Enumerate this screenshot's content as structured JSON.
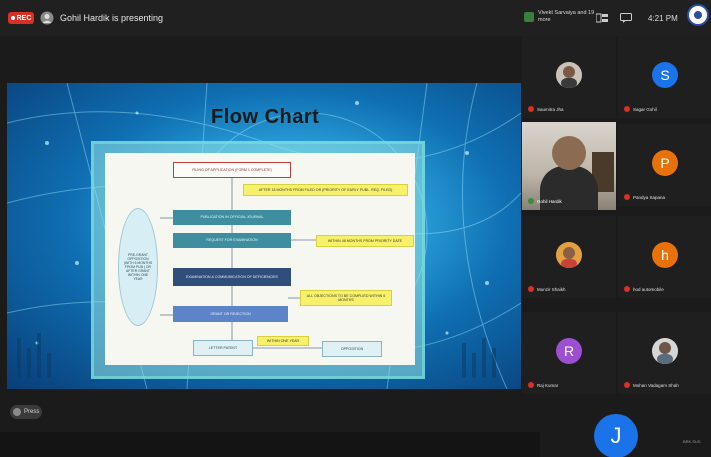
{
  "topbar": {
    "rec_label": "REC",
    "presenting_text": "Gohil Hardik is presenting",
    "viewers_text": "Vivekt Sarvaiya and 19 more",
    "time": "4:21 PM"
  },
  "slide": {
    "title": "Flow Chart",
    "boxes": [
      "FILING OF APPLICATION (FORM 1 COMPLETE)",
      "AFTER 18 MONTHS FROM FILED OR (PRIORITY OF EARLY PUBL. REQ. FILED)",
      "PUBLICATION IN OFFICIAL JOURNAL",
      "REQUEST FOR EXAMINATION",
      "WITHIN 48 MONTHS FROM PRIORITY DATE",
      "EXAMINATION & COMMUNICATION OF DEFICIENCIES",
      "ALL OBJECTIONS TO BE COMPLIED WITHIN 6 MONTHS",
      "GRANT OR REJECTION",
      "LETTER PATENT",
      "WITHIN ONE YEAR",
      "OPPOSITION"
    ],
    "ellipse_text": "PRE-GRANT OPPOSITION (WITH 6 MONTHS FROM PUB.) OR AFTER GRANT WITHIN ONE YEAR",
    "press_label": "Press"
  },
  "participants": [
    {
      "name": "Saumitra Jha",
      "type": "photo"
    },
    {
      "name": "Sagar Gohil",
      "type": "letter",
      "letter": "S",
      "color": "#1a73e8"
    },
    {
      "name": "Gohil Hardik",
      "type": "video"
    },
    {
      "name": "Pandya Sapana",
      "type": "letter",
      "letter": "P",
      "color": "#e8710a"
    },
    {
      "name": "Munzir Shaikh",
      "type": "photo"
    },
    {
      "name": "hod automobile",
      "type": "letter",
      "letter": "h",
      "color": "#e8710a"
    },
    {
      "name": "Raj Kumar",
      "type": "letter",
      "letter": "R",
      "color": "#9c4fd0"
    },
    {
      "name": "Mohan Vadagam Shah",
      "type": "photo"
    }
  ],
  "bottom": {
    "big_letter": "J",
    "big_color": "#1a73e8",
    "tiny_label": "BRK.SUS"
  }
}
